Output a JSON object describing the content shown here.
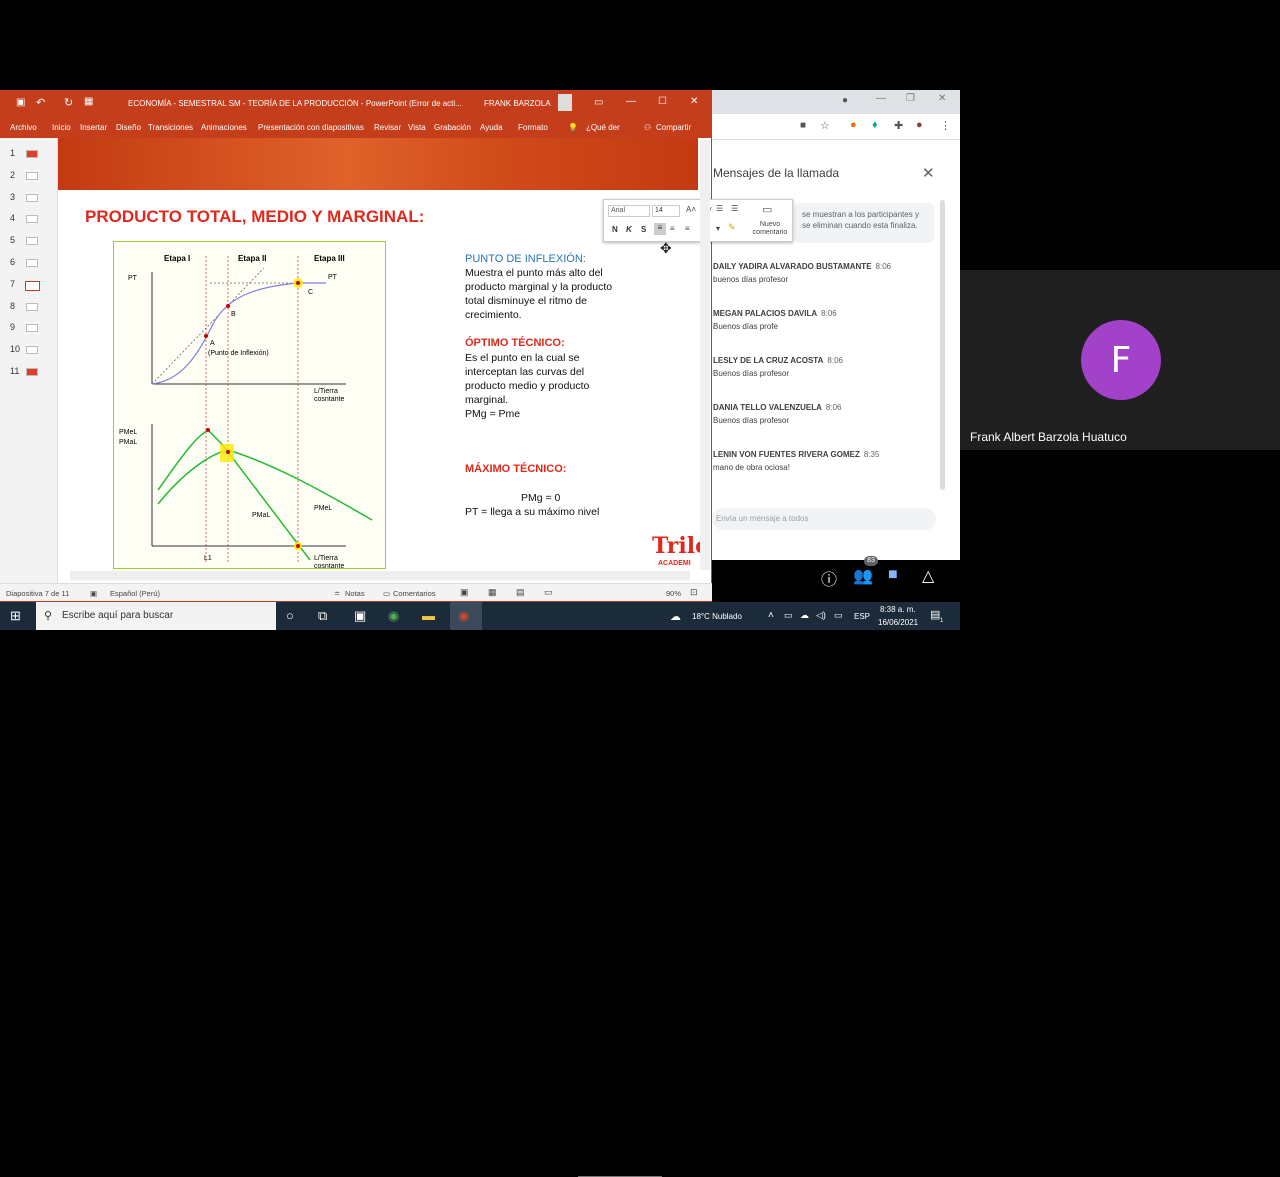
{
  "ppt": {
    "title": "ECONOMÍA - SEMESTRAL SM - TEORÍA DE LA PRODUCCIÓN  -  PowerPoint (Error de acti...",
    "user": "FRANK BARZOLA",
    "ribbon": [
      "Archivo",
      "Inicio",
      "Insertar",
      "Diseño",
      "Transiciones",
      "Animaciones",
      "Presentación con diapositivas",
      "Revisar",
      "Vista",
      "Grabación",
      "Ayuda",
      "Formato"
    ],
    "tell_me": "¿Qué der",
    "share": "Compartir",
    "thumbs": [
      "1",
      "2",
      "3",
      "4",
      "5",
      "6",
      "7",
      "8",
      "9",
      "10",
      "11"
    ],
    "format_toolbar": {
      "font": "Arial",
      "size": "14",
      "bold": "N",
      "italic": "K",
      "shadow": "S",
      "new_comment": "Nuevo comentario"
    },
    "status": {
      "slide": "Diapositiva 7 de 11",
      "lang": "Español (Perú)",
      "notes": "Notas",
      "comments": "Comentarios",
      "zoom": "90%"
    }
  },
  "slide": {
    "title": "PRODUCTO TOTAL, MEDIO Y MARGINAL:",
    "graph": {
      "stage1": "Etapa I",
      "stage2": "Etapa II",
      "stage3": "Etapa III",
      "pt_left": "PT",
      "pt_right": "PT",
      "a": "A",
      "b": "B",
      "c": "C",
      "inflection": "(Punto de Inflexión)",
      "x_axis_1": "L/Tierra",
      "x_axis_1b": "cosntante",
      "pmel": "PMeL",
      "pmal": "PMaL",
      "pmel2": "PMeL",
      "pmal2": "PMaL",
      "l1": "L1",
      "x_axis_2": "L/Tierra",
      "x_axis_2b": "cosntante"
    },
    "inflexion_head": "PUNTO DE INFLEXIÓN:",
    "inflexion_text": [
      "Muestra el punto más alto del",
      "producto marginal y la producto",
      "total disminuye el ritmo de",
      "crecimiento."
    ],
    "optimo_head": "ÓPTIMO TÉCNICO:",
    "optimo_text": [
      "Es el punto en la cual se",
      "interceptan las curvas del",
      "producto medio y producto",
      "marginal.",
      "PMg = Pme"
    ],
    "maximo_head": "MÁXIMO TÉCNICO:",
    "maximo_eq": "PMg = 0",
    "maximo_text": "PT = llega a su máximo nivel",
    "logo": "Trilc",
    "logo_sub": "ACADEMI"
  },
  "chat": {
    "title": "Mensajes de la llamada",
    "info": "se muestran a los participantes y se eliminan cuando esta finaliza.",
    "messages": [
      {
        "name": "DAILY YADIRA ALVARADO BUSTAMANTE",
        "time": "8:06",
        "text": "buenos días profesor"
      },
      {
        "name": "MEGAN PALACIOS DAVILA",
        "time": "8:06",
        "text": "Buenos días profe"
      },
      {
        "name": "LESLY DE LA CRUZ ACOSTA",
        "time": "8:06",
        "text": "Buenos días profesor"
      },
      {
        "name": "DANIA TELLO VALENZUELA",
        "time": "8:06",
        "text": "Buenos días profesor"
      },
      {
        "name": "LENIN VON FUENTES RIVERA GOMEZ",
        "time": "8:35",
        "text": "mano de obra ociosa!"
      }
    ],
    "input_placeholder": "Envía un mensaje a todos",
    "participants_count": "83"
  },
  "tile": {
    "initial": "F",
    "name": "Frank Albert Barzola Huatuco"
  },
  "taskbar": {
    "search": "Escribe aquí para buscar",
    "weather": "18°C  Nublado",
    "lang": "ESP",
    "time": "8:38 a. m.",
    "date": "16/06/2021",
    "notif": "1"
  }
}
